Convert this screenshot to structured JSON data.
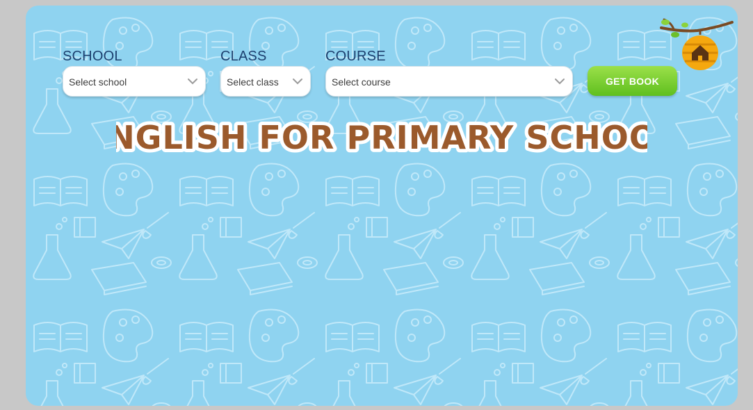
{
  "filters": {
    "school": {
      "label": "SCHOOL",
      "placeholder": "Select school"
    },
    "class": {
      "label": "CLASS",
      "placeholder": "Select class"
    },
    "course": {
      "label": "COURSE",
      "placeholder": "Select course"
    }
  },
  "actions": {
    "get_book_label": "GET BOOK"
  },
  "page": {
    "title": "ENGLISH FOR PRIMARY SCHOOL"
  },
  "icons": {
    "home": "home-icon",
    "chevron": "chevron-down-icon",
    "background": "school-doodle-pattern"
  },
  "colors": {
    "background": "#8fd3f0",
    "label_text": "#1c3f6e",
    "title_fill": "#9b5a2c",
    "button_green": "#6cc72a",
    "hive": "#f5a80f"
  }
}
